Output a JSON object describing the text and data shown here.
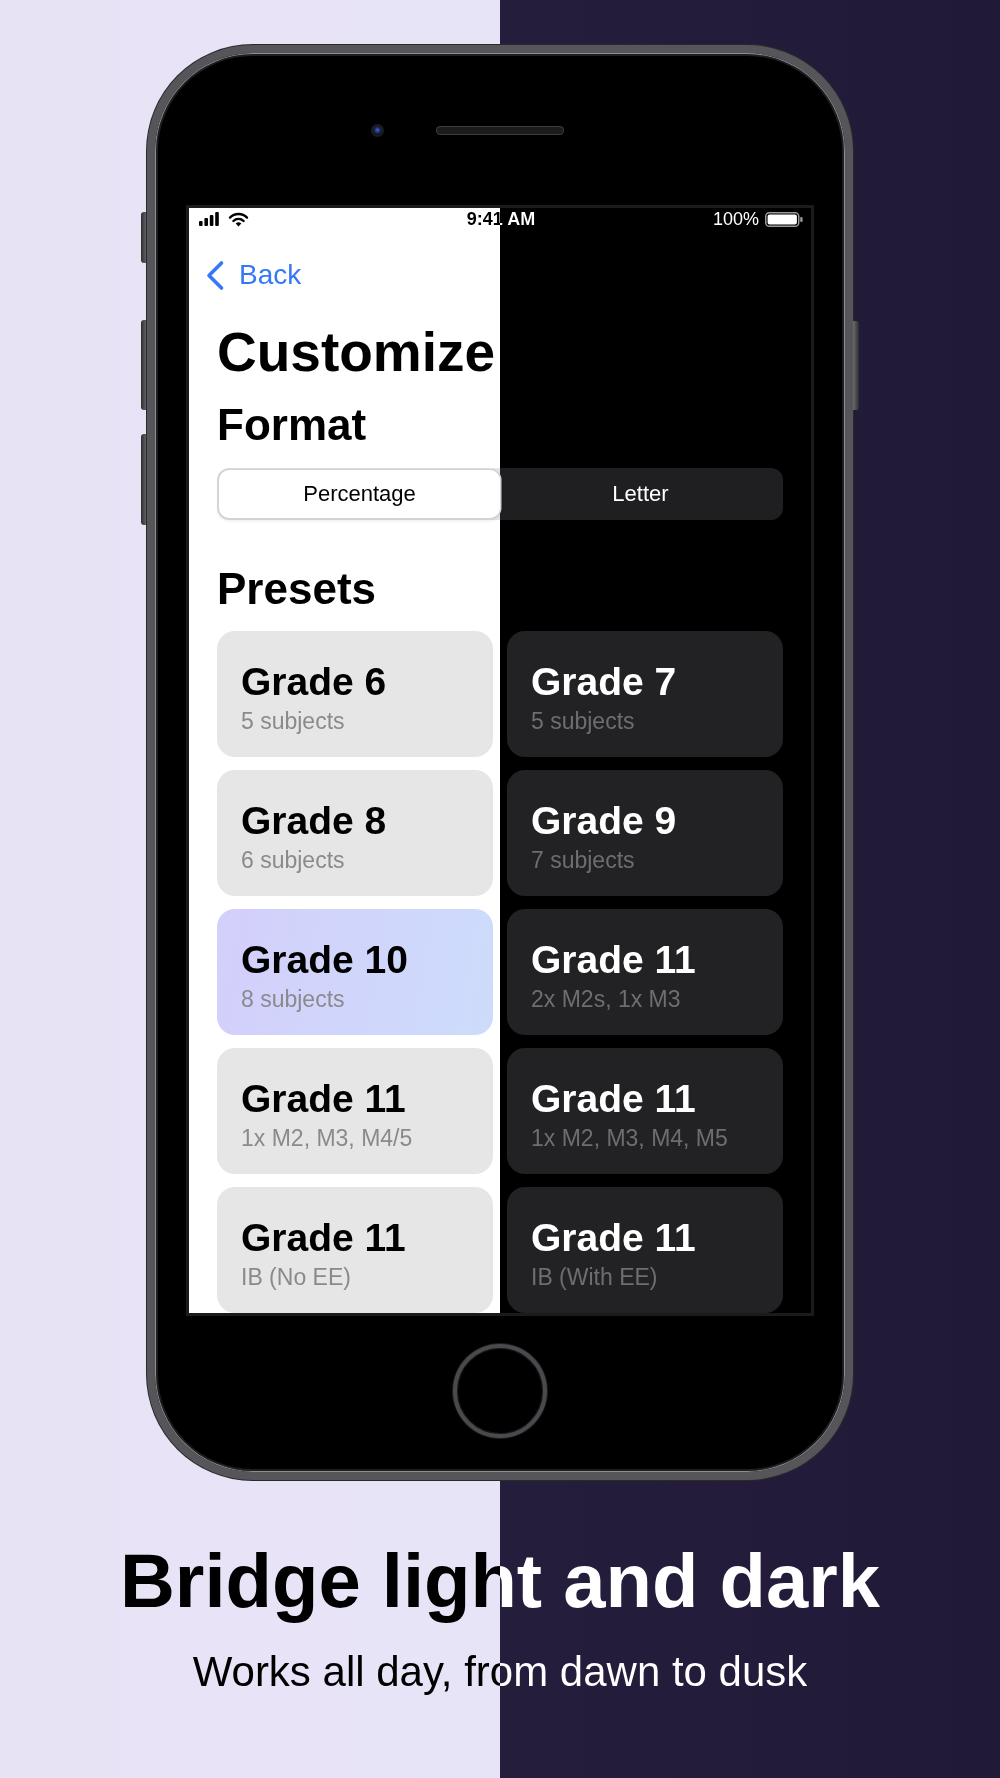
{
  "status_bar": {
    "time": "9:41 AM",
    "battery": "100%"
  },
  "nav": {
    "back": "Back"
  },
  "title": "Customize",
  "format": {
    "heading": "Format",
    "segments": [
      {
        "label": "Percentage",
        "selected": true
      },
      {
        "label": "Letter",
        "selected": false
      }
    ]
  },
  "presets": {
    "heading": "Presets",
    "items": [
      {
        "title": "Grade 6",
        "subtitle": "5 subjects",
        "selected": false
      },
      {
        "title": "Grade 7",
        "subtitle": "5 subjects",
        "selected": false
      },
      {
        "title": "Grade 8",
        "subtitle": "6 subjects",
        "selected": false
      },
      {
        "title": "Grade 9",
        "subtitle": "7 subjects",
        "selected": false
      },
      {
        "title": "Grade 10",
        "subtitle": "8 subjects",
        "selected": true
      },
      {
        "title": "Grade 11",
        "subtitle": "2x M2s, 1x M3",
        "selected": false
      },
      {
        "title": "Grade 11",
        "subtitle": "1x M2, M3, M4/5",
        "selected": false
      },
      {
        "title": "Grade 11",
        "subtitle": "1x M2, M3, M4, M5",
        "selected": false
      },
      {
        "title": "Grade 11",
        "subtitle": "IB (No EE)",
        "selected": false
      },
      {
        "title": "Grade 11",
        "subtitle": "IB (With EE)",
        "selected": false
      }
    ]
  },
  "caption": {
    "headline": "Bridge light and dark",
    "subheadline": "Works all day, from dawn to dusk"
  }
}
